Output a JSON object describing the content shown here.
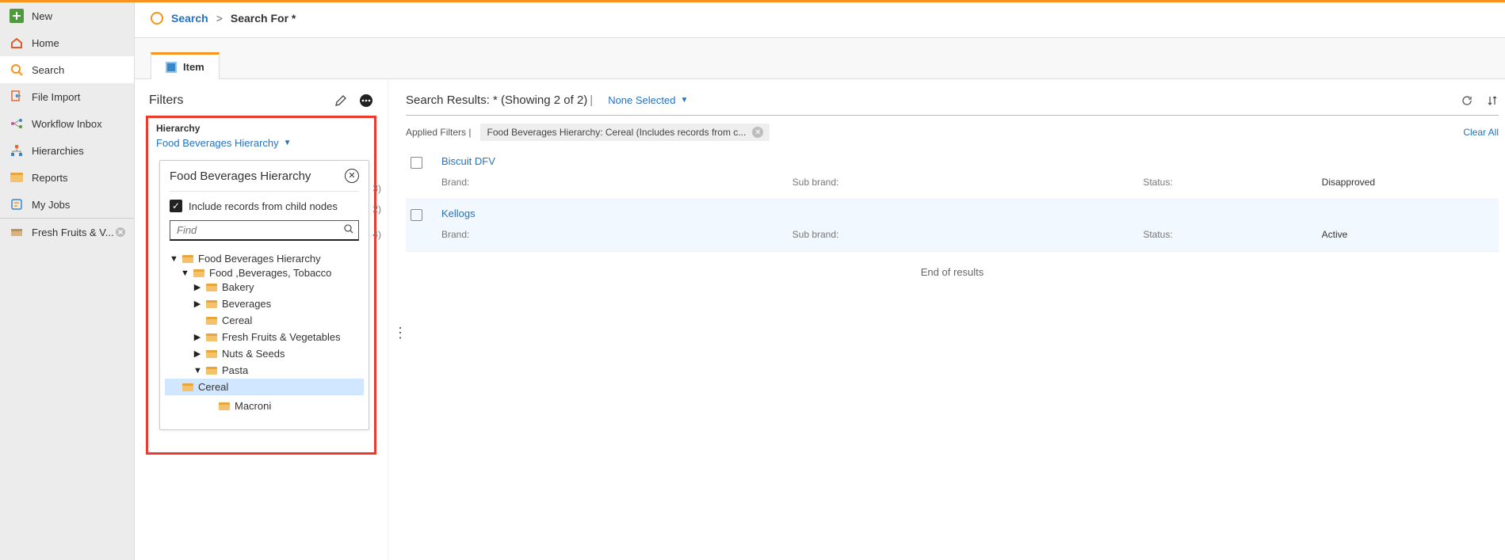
{
  "sidebar": {
    "items": [
      {
        "label": "New"
      },
      {
        "label": "Home"
      },
      {
        "label": "Search"
      },
      {
        "label": "File Import"
      },
      {
        "label": "Workflow Inbox"
      },
      {
        "label": "Hierarchies"
      },
      {
        "label": "Reports"
      },
      {
        "label": "My Jobs"
      }
    ],
    "bottom_item": "Fresh Fruits & V..."
  },
  "breadcrumb": {
    "link": "Search",
    "sep": ">",
    "current": "Search For *"
  },
  "tabs": {
    "item_label": "Item"
  },
  "filters": {
    "title": "Filters",
    "hierarchy_label": "Hierarchy",
    "hierarchy_link": "Food Beverages Hierarchy",
    "popout_title": "Food Beverages Hierarchy",
    "include_label": "Include records from child nodes",
    "find_placeholder": "Find",
    "counts": [
      "3)",
      "2)",
      "4)"
    ],
    "tree": {
      "root": "Food Beverages Hierarchy",
      "level1": "Food ,Beverages, Tobacco",
      "bakery": "Bakery",
      "beverages": "Beverages",
      "cereal": "Cereal",
      "fresh": "Fresh Fruits & Vegetables",
      "nuts": "Nuts & Seeds",
      "pasta": "Pasta",
      "pasta_cereal": "Cereal",
      "pasta_macroni": "Macroni"
    }
  },
  "results": {
    "title_prefix": "Search Results: * (Showing 2 of 2)",
    "none_selected": "None Selected",
    "applied_label": "Applied Filters |",
    "chip": "Food Beverages Hierarchy: Cereal (Includes records from c...",
    "clear_all": "Clear All",
    "meta": {
      "brand": "Brand:",
      "subbrand": "Sub brand:",
      "status": "Status:"
    },
    "rows": [
      {
        "title": "Biscuit DFV",
        "status": "Disapproved"
      },
      {
        "title": "Kellogs",
        "status": "Active"
      }
    ],
    "eor": "End of results"
  }
}
